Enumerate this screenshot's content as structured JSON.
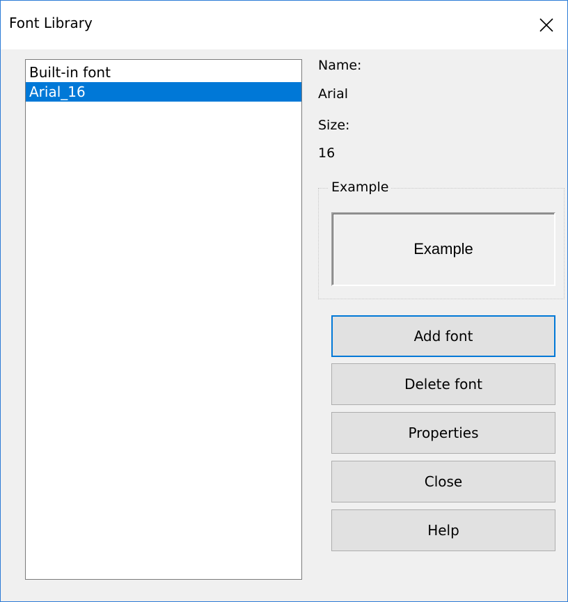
{
  "window": {
    "title": "Font Library"
  },
  "font_list": {
    "items": [
      {
        "label": "Built-in font",
        "selected": false
      },
      {
        "label": "Arial_16",
        "selected": true
      }
    ]
  },
  "details": {
    "name_label": "Name:",
    "name_value": "Arial",
    "size_label": "Size:",
    "size_value": "16"
  },
  "example": {
    "group_label": "Example",
    "preview_text": "Example"
  },
  "buttons": {
    "add": "Add font",
    "delete": "Delete font",
    "properties": "Properties",
    "close": "Close",
    "help": "Help"
  },
  "colors": {
    "selection": "#0078d7",
    "dialog_border": "#2b7ad6",
    "background": "#f0f0f0"
  },
  "icons": {
    "close": "close-icon"
  }
}
